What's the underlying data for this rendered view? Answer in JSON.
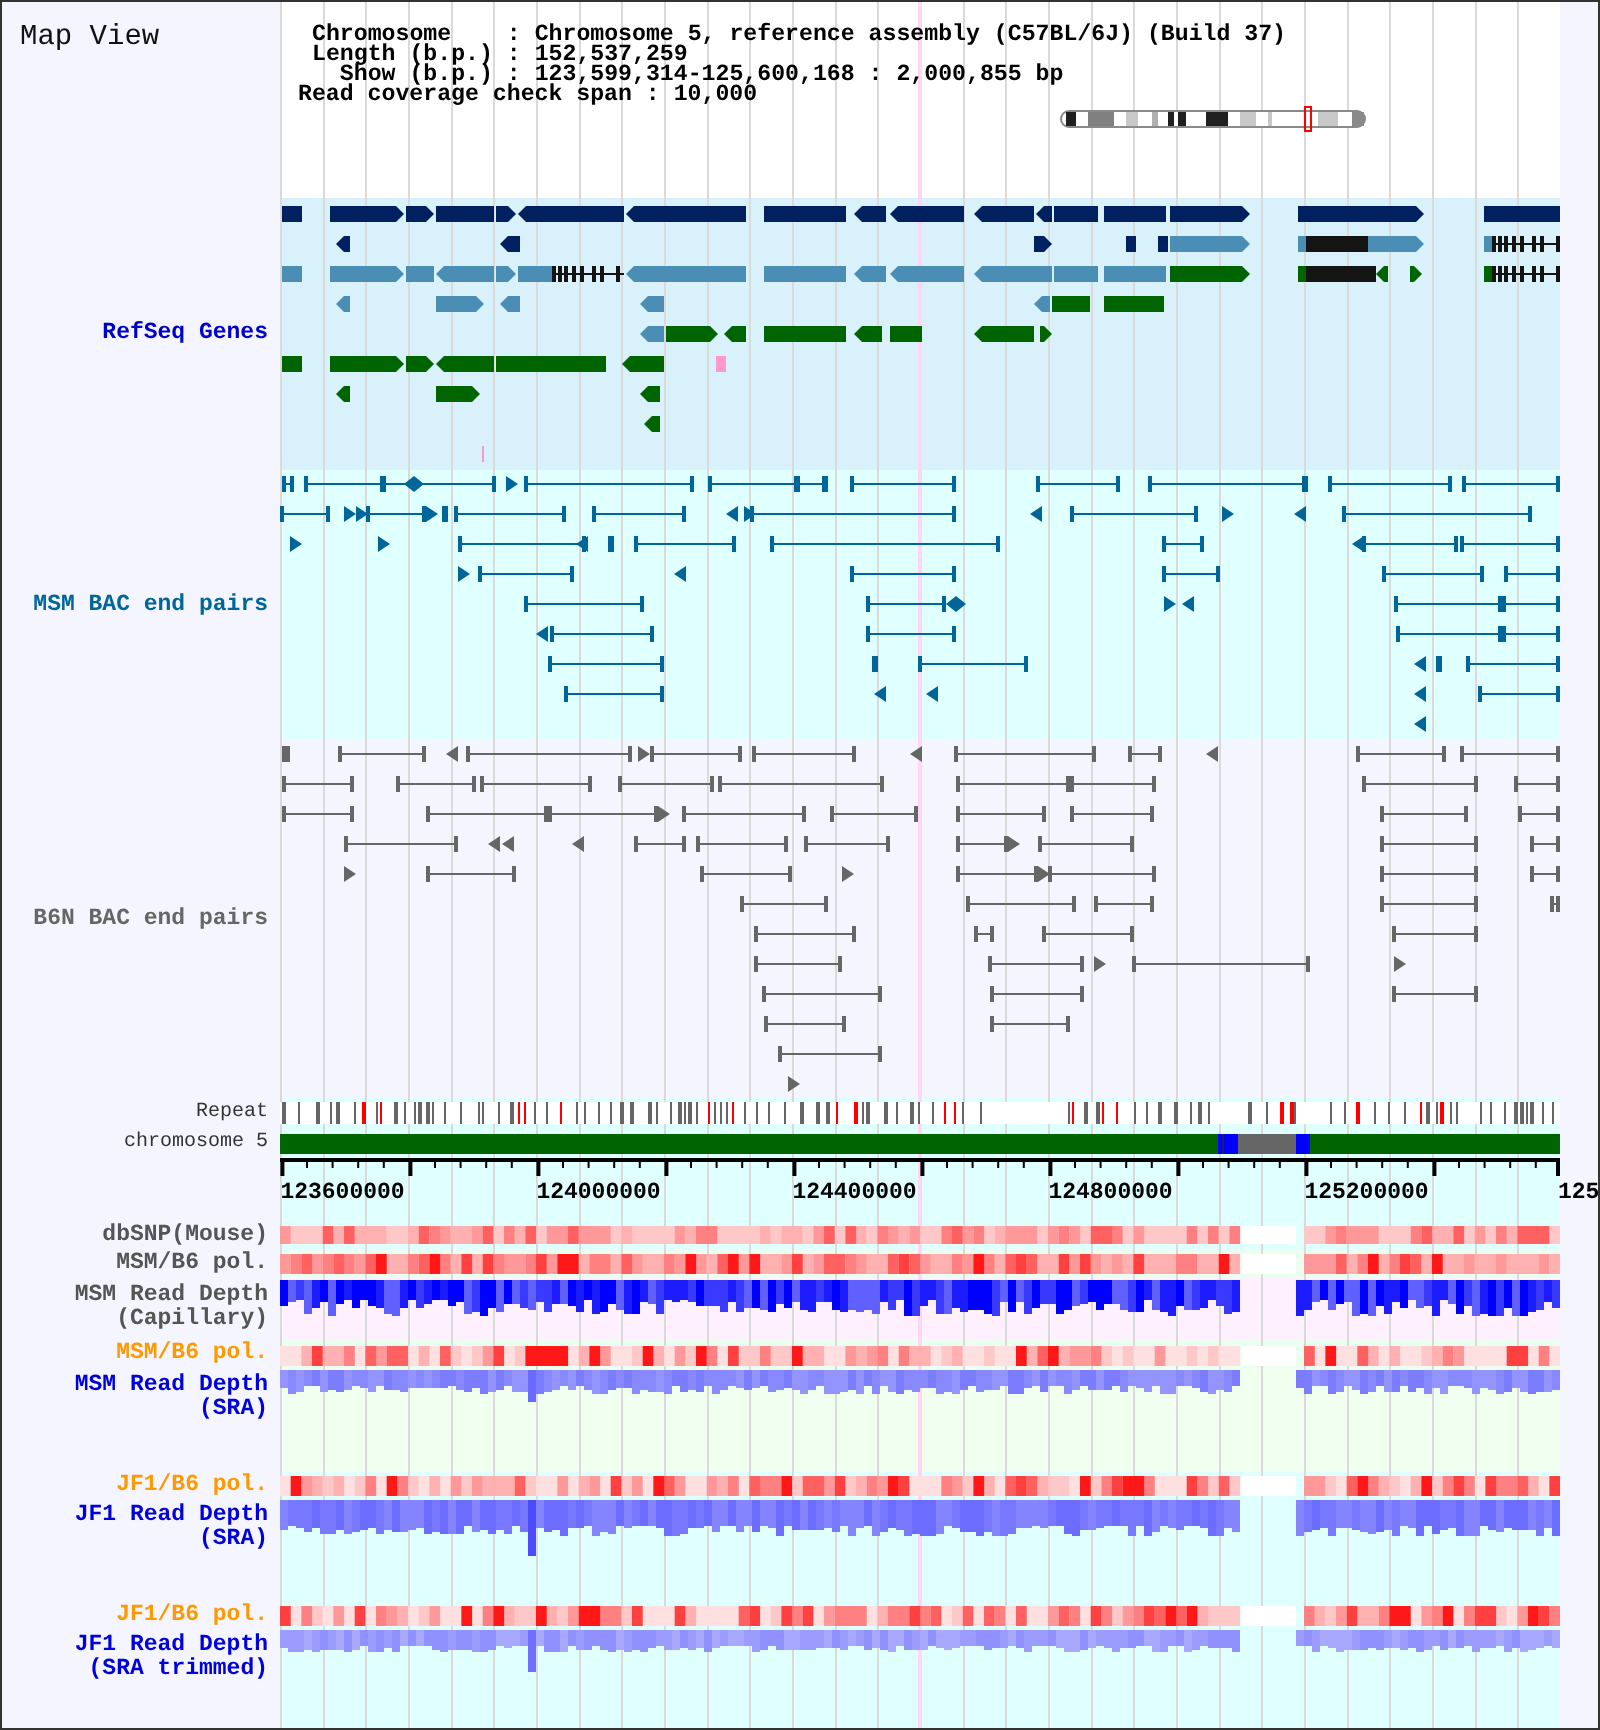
{
  "title": "Map View",
  "info": {
    "lines": [
      "Chromosome    : Chromosome 5, reference assembly (C57BL/6J) (Build 37)",
      "Length (b.p.) : 152,537,259",
      "  Show (b.p.) : 123,599,314-125,600,168 : 2,000,855 bp"
    ],
    "coverage_span": "Read coverage check span : 10,000"
  },
  "tracks": [
    {
      "kind": "genes",
      "label": "RefSeq Genes",
      "color": "#0000cc"
    },
    {
      "kind": "bac_pairs",
      "label": "MSM BAC end pairs",
      "color": "#006699"
    },
    {
      "kind": "bac_pairs",
      "label": "B6N BAC end pairs",
      "color": "#666666"
    },
    {
      "kind": "repeats",
      "label": "Repeat",
      "color": "#333333"
    },
    {
      "kind": "chromosome",
      "label": "chromosome 5",
      "color": "#333333"
    },
    {
      "kind": "axis",
      "ticks": [
        "123600000",
        "124000000",
        "124400000",
        "124800000",
        "125200000",
        "125"
      ]
    },
    {
      "kind": "heatmap",
      "label": "dbSNP(Mouse)",
      "color": "#555555"
    },
    {
      "kind": "heatmap",
      "label": "MSM/B6 pol.",
      "color": "#555555"
    },
    {
      "kind": "depth",
      "label": "MSM Read Depth (Capillary)",
      "color": "#555555"
    },
    {
      "kind": "heatmap",
      "label": "MSM/B6 pol.",
      "color": "#ff9900"
    },
    {
      "kind": "depth",
      "label": "MSM Read Depth (SRA)",
      "color": "#0000dd"
    },
    {
      "kind": "heatmap",
      "label": "JF1/B6 pol.",
      "color": "#ff9900"
    },
    {
      "kind": "depth",
      "label": "JF1 Read Depth (SRA)",
      "color": "#0000dd"
    },
    {
      "kind": "heatmap",
      "label": "JF1/B6 pol.",
      "color": "#ff9900"
    },
    {
      "kind": "depth",
      "label": "JF1 Read Depth (SRA trimmed)",
      "color": "#0000dd"
    }
  ]
}
